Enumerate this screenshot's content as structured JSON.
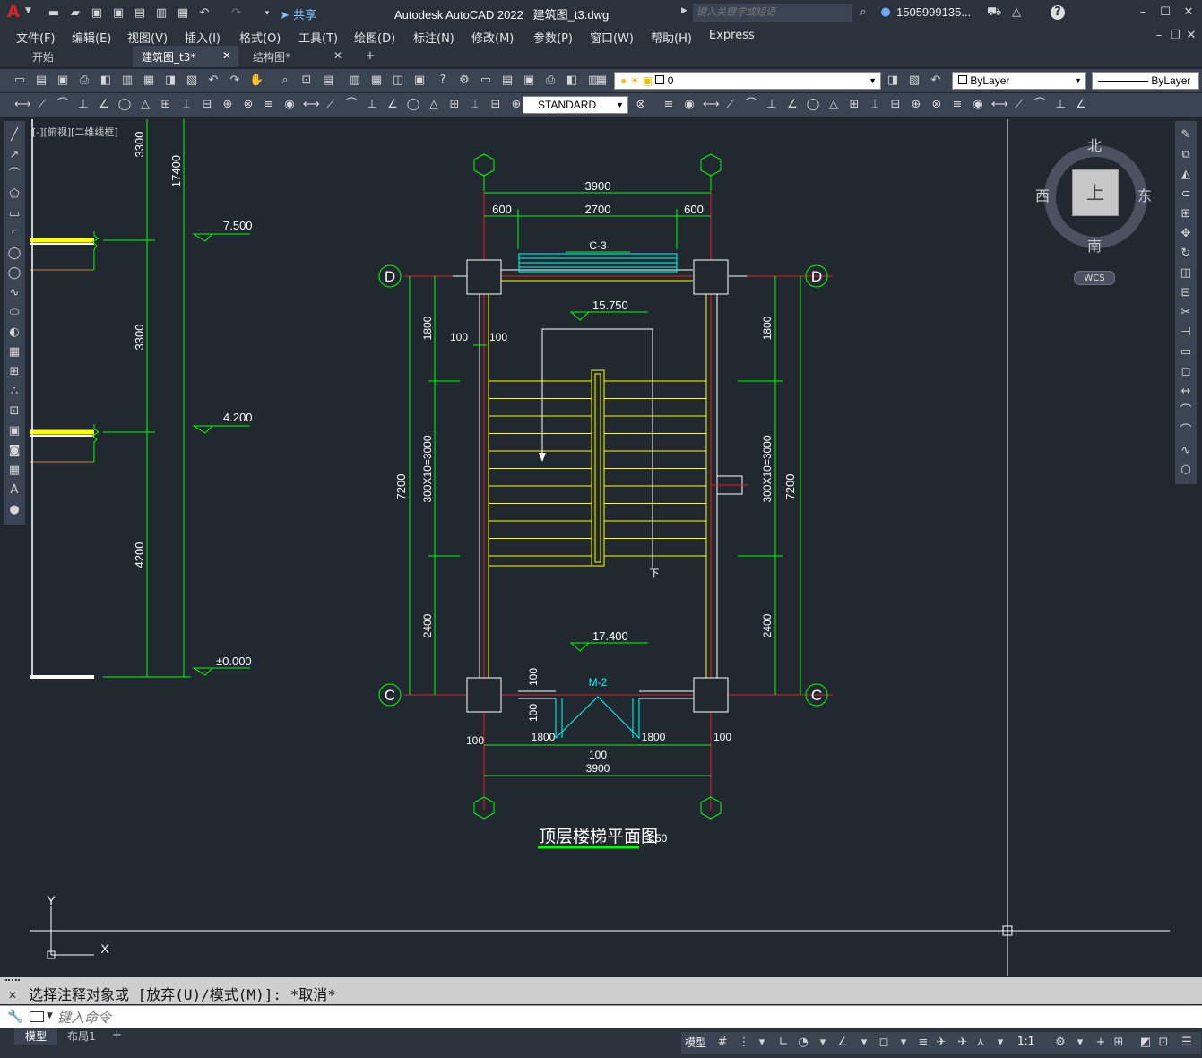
{
  "app": {
    "title": "Autodesk AutoCAD 2022",
    "file": "建筑图_t3.dwg",
    "search_placeholder": "键入关键字或短语",
    "user": "1505999135...",
    "share": "共享"
  },
  "menu": [
    "文件(F)",
    "编辑(E)",
    "视图(V)",
    "插入(I)",
    "格式(O)",
    "工具(T)",
    "绘图(D)",
    "标注(N)",
    "修改(M)",
    "参数(P)",
    "窗口(W)",
    "帮助(H)",
    "Express"
  ],
  "tabs": [
    "开始",
    "建筑图_t3*",
    "结构图*"
  ],
  "layer": {
    "name": "0",
    "color_value": "ByLayer",
    "linetype_value": "ByLayer",
    "textstyle_value": "STANDARD"
  },
  "viewport_label": "[-][俯视][二维线框]",
  "viewcube": {
    "north": "北",
    "south": "南",
    "east": "东",
    "west": "西",
    "face": "上",
    "wcs": "WCS"
  },
  "section": {
    "dims": [
      "3300",
      "3300",
      "4200",
      "17400"
    ],
    "levels": [
      "7.500",
      "4.200",
      "±0.000"
    ]
  },
  "plan": {
    "title": "顶层楼梯平面图",
    "scale": "1:50",
    "axes": [
      "D",
      "C"
    ],
    "window": "C-3",
    "door": "M-2",
    "levels": [
      "15.750",
      "17.400"
    ],
    "down_label": "下",
    "top_dims": [
      "3900",
      "600",
      "2700",
      "600"
    ],
    "bottom_dims": [
      "100",
      "1800",
      "100",
      "1800",
      "100",
      "3900"
    ],
    "left_dims": [
      "1800",
      "300X10=3000",
      "2400",
      "7200",
      "100",
      "100",
      "100",
      "100"
    ],
    "right_dims": [
      "1800",
      "300X10=3000",
      "2400",
      "7200"
    ]
  },
  "command": {
    "history": "选择注释对象或 [放弃(U)/模式(M)]: *取消*",
    "placeholder": "键入命令"
  },
  "status": {
    "model_tab": "模型",
    "layout_tab": "布局1",
    "model_label": "模型",
    "scale": "1:1"
  },
  "colors": {
    "accent_red": "#e02020",
    "canvas": "#212830",
    "green": "#00ff00",
    "yellow": "#ffff00",
    "cyan": "#00ffff"
  }
}
